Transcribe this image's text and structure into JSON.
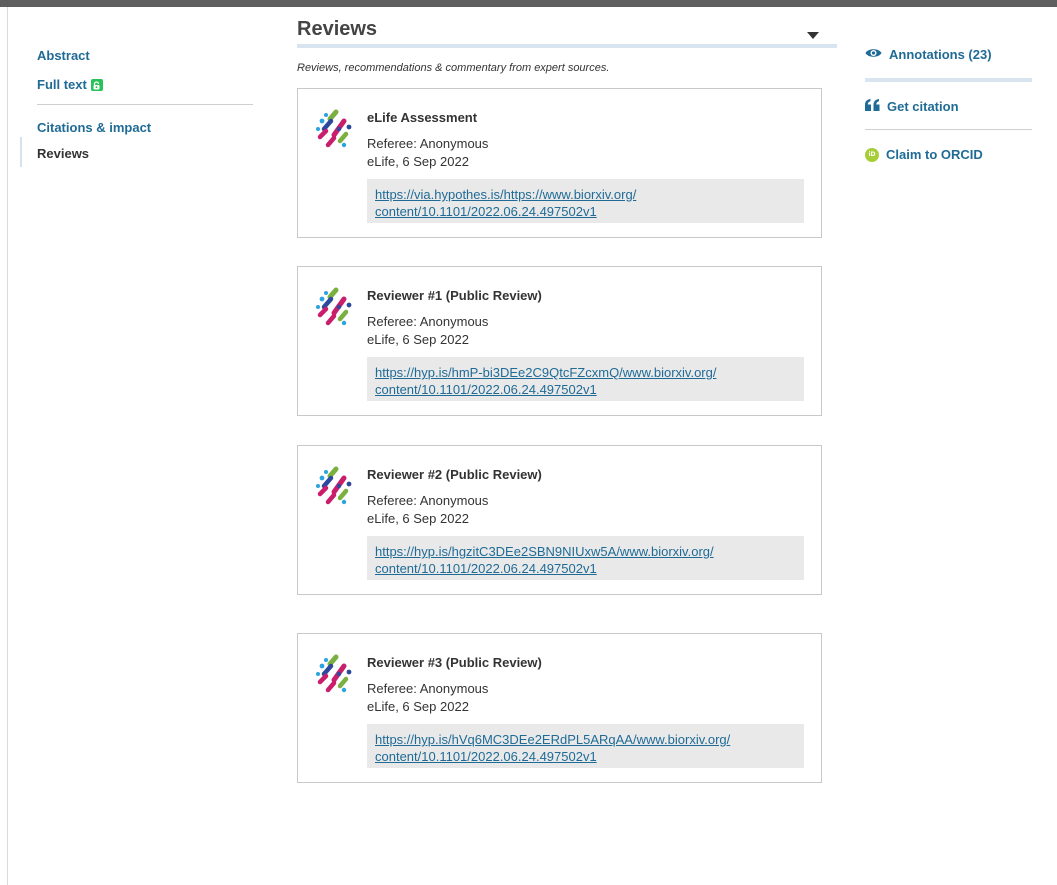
{
  "nav": {
    "abstract": "Abstract",
    "full_text": "Full text",
    "citations": "Citations & impact",
    "reviews": "Reviews"
  },
  "section": {
    "title": "Reviews",
    "subtitle": "Reviews, recommendations & commentary from expert sources."
  },
  "reviews": [
    {
      "title": "eLife Assessment",
      "referee": "Referee: Anonymous",
      "date": "eLife, 6 Sep 2022",
      "link": "https://via.hypothes.is/https://www.biorxiv.org/content/10.1101/2022.06.24.497502v1",
      "link_line1": "https://via.hypothes.is/https://www.biorxiv.org/",
      "link_line2": "content/10.1101/2022.06.24.497502v1"
    },
    {
      "title": "Reviewer #1 (Public Review)",
      "referee": "Referee: Anonymous",
      "date": "eLife, 6 Sep 2022",
      "link": "https://hyp.is/hmP-bi3DEe2C9QtcFZcxmQ/www.biorxiv.org/content/10.1101/2022.06.24.497502v1",
      "link_line1": "https://hyp.is/hmP-bi3DEe2C9QtcFZcxmQ/www.biorxiv.org/",
      "link_line2": "content/10.1101/2022.06.24.497502v1"
    },
    {
      "title": "Reviewer #2 (Public Review)",
      "referee": "Referee: Anonymous",
      "date": "eLife, 6 Sep 2022",
      "link": "https://hyp.is/hgzitC3DEe2SBN9NIUxw5A/www.biorxiv.org/content/10.1101/2022.06.24.497502v1",
      "link_line1": "https://hyp.is/hgzitC3DEe2SBN9NIUxw5A/www.biorxiv.org/",
      "link_line2": "content/10.1101/2022.06.24.497502v1"
    },
    {
      "title": "Reviewer #3 (Public Review)",
      "referee": "Referee: Anonymous",
      "date": "eLife, 6 Sep 2022",
      "link": "https://hyp.is/hVq6MC3DEe2ERdPL5ARqAA/www.biorxiv.org/content/10.1101/2022.06.24.497502v1",
      "link_line1": "https://hyp.is/hVq6MC3DEe2ERdPL5ARqAA/www.biorxiv.org/",
      "link_line2": "content/10.1101/2022.06.24.497502v1"
    }
  ],
  "right_panel": {
    "annotations": "Annotations (23)",
    "get_citation": "Get citation",
    "claim_orcid": "Claim to ORCID",
    "orcid_icon_text": "iD"
  },
  "icons": {
    "annotations": "eye-icon",
    "citation": "quote-icon",
    "orcid": "orcid-icon",
    "full_text": "open-access-icon",
    "collapse": "caret-down-icon",
    "reviewer_logo": "reviewer-logo-icon"
  },
  "colors": {
    "link": "#1f6b96",
    "header_accent": "#d8e5f0",
    "open_access_green": "#27c25a",
    "orcid_green": "#a6ce39",
    "link_box_bg": "#e9e9e9",
    "top_bar": "#5f5f5f"
  }
}
